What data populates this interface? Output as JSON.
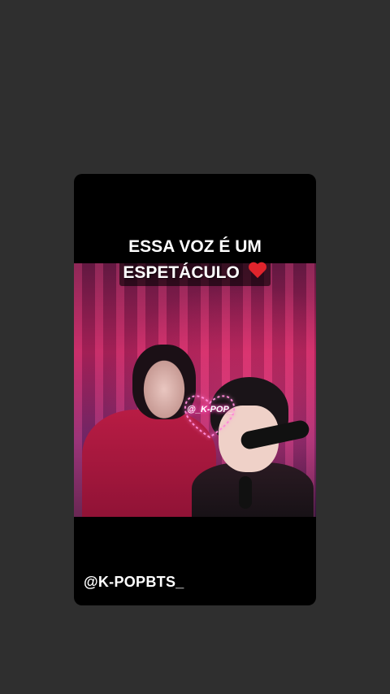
{
  "story": {
    "headline_line1": "ESSA VOZ É UM",
    "headline_line2": "ESPETÁCULO",
    "headline_emoji": "heart-icon",
    "watermark": "@_K-POP_",
    "handle": "@K-POPBTS_"
  },
  "colors": {
    "page_background": "#2f2f2f",
    "card_background": "#000000",
    "heart": "#e0242c",
    "stage_pink": "#b8245f"
  }
}
